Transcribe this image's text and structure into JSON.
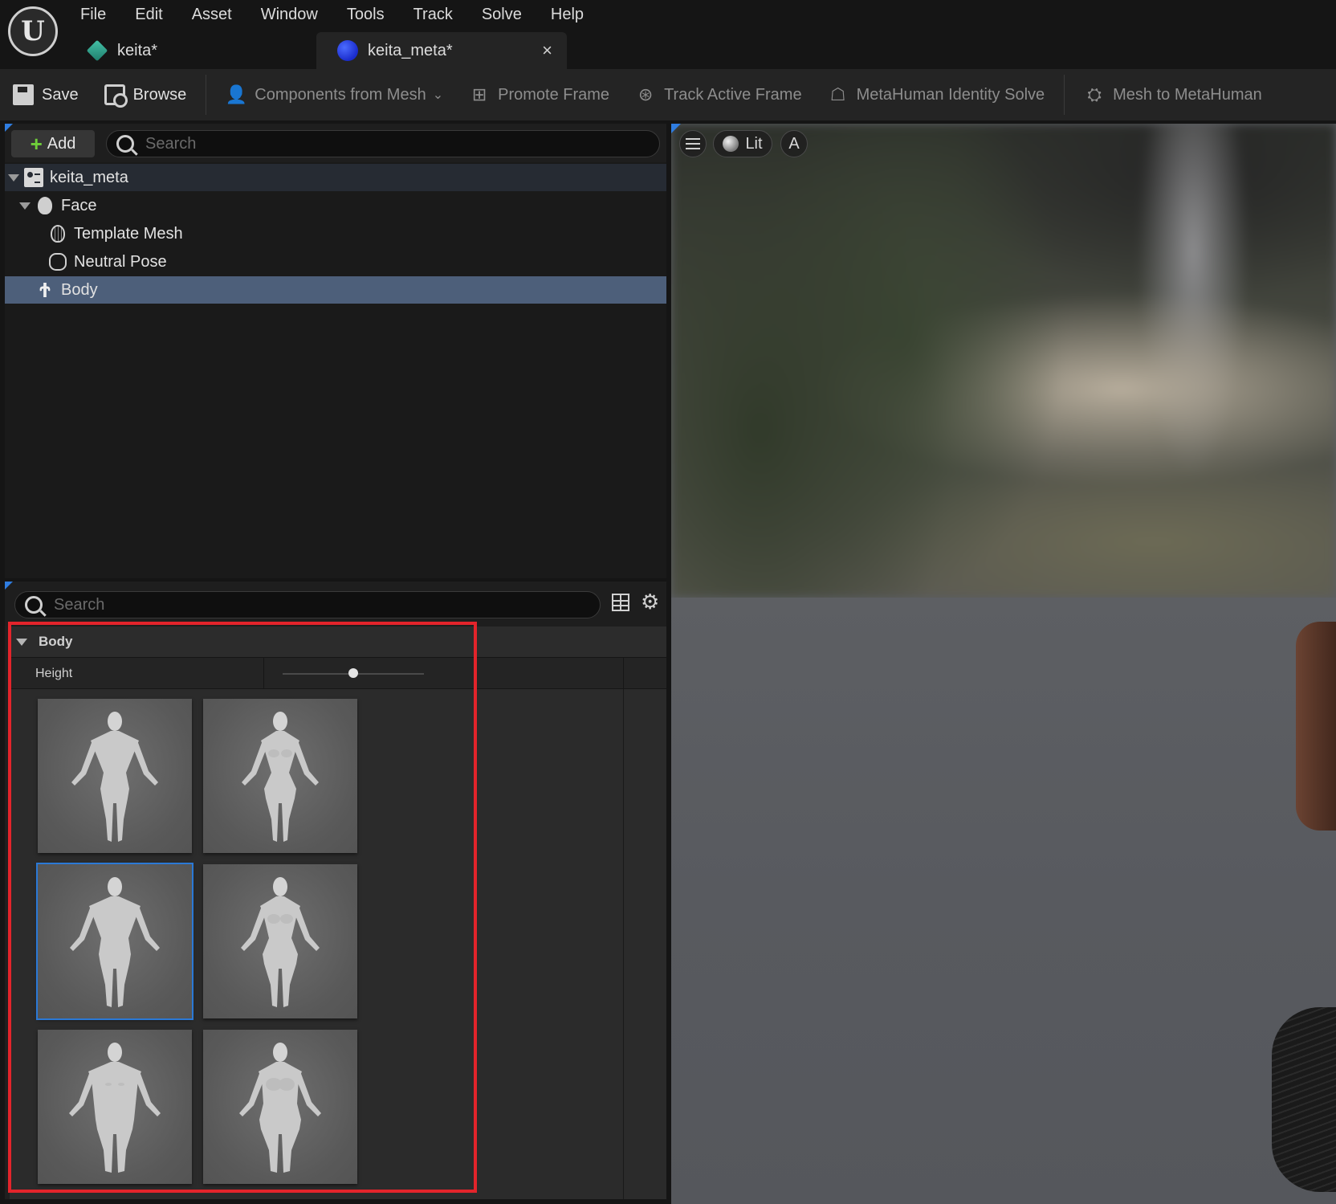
{
  "menu": [
    "File",
    "Edit",
    "Asset",
    "Window",
    "Tools",
    "Track",
    "Solve",
    "Help"
  ],
  "tabs": [
    {
      "label": "keita*",
      "icon": "cube-icon",
      "active": false
    },
    {
      "label": "keita_meta*",
      "icon": "globe-icon",
      "active": true
    }
  ],
  "toolbar": {
    "save": "Save",
    "browse": "Browse",
    "components_from_mesh": "Components from Mesh",
    "promote_frame": "Promote Frame",
    "track_active_frame": "Track Active Frame",
    "identity_solve": "MetaHuman Identity Solve",
    "mesh_to_metahuman": "Mesh to MetaHuman"
  },
  "tree": {
    "add_label": "Add",
    "search_placeholder": "Search",
    "items": [
      {
        "label": "keita_meta",
        "icon": "identity-icon",
        "depth": 0
      },
      {
        "label": "Face",
        "icon": "face-icon",
        "depth": 1
      },
      {
        "label": "Template Mesh",
        "icon": "mesh-head-icon",
        "depth": 2
      },
      {
        "label": "Neutral Pose",
        "icon": "pose-icon",
        "depth": 2
      },
      {
        "label": "Body",
        "icon": "body-icon",
        "depth": 1,
        "selected": true
      }
    ]
  },
  "details": {
    "search_placeholder": "Search",
    "section": "Body",
    "height_label": "Height",
    "height_value": 0.5,
    "body_types": [
      {
        "name": "body-type-1",
        "build": "male-average"
      },
      {
        "name": "body-type-2",
        "build": "female-average"
      },
      {
        "name": "body-type-3",
        "build": "male-medium",
        "selected": true
      },
      {
        "name": "body-type-4",
        "build": "female-medium"
      },
      {
        "name": "body-type-5",
        "build": "male-heavy"
      },
      {
        "name": "body-type-6",
        "build": "female-heavy"
      }
    ]
  },
  "viewport": {
    "view_mode": "Lit",
    "auto_label": "A"
  },
  "colors": {
    "accent": "#2f7de0",
    "selection": "#4d5f7a",
    "highlight_box": "#e3242b"
  }
}
